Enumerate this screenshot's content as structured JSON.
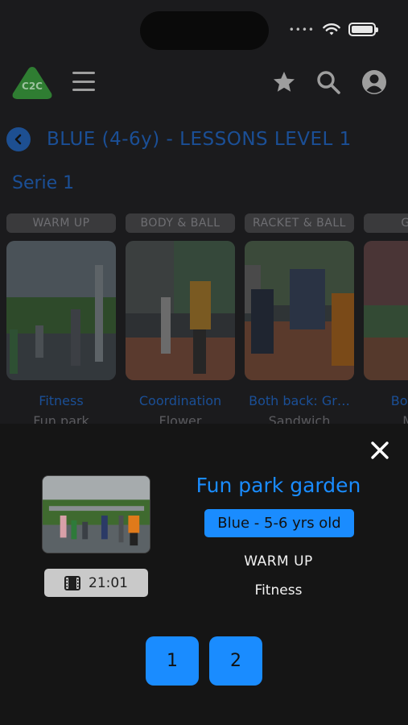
{
  "header": {
    "title": "BLUE (4-6y) - LESSONS LEVEL 1",
    "logo_text": "C2C",
    "icons": [
      "menu-icon",
      "star-icon",
      "search-icon",
      "user-icon"
    ]
  },
  "serie": {
    "label": "Serie 1"
  },
  "categories": [
    "WARM UP",
    "BODY & BALL",
    "RACKET & BALL",
    "GAME"
  ],
  "cards": [
    {
      "title": "Fitness",
      "subtitle": "Fun park"
    },
    {
      "title": "Coordination",
      "subtitle": "Flower"
    },
    {
      "title": "Both back: Gr…",
      "subtitle": "Sandwich"
    },
    {
      "title": "Both b…",
      "subtitle": "Mo…"
    }
  ],
  "sheet": {
    "lesson_title": "Fun park garden",
    "level_badge": "Blue - 5-6 yrs old",
    "category": "WARM UP",
    "subcategory": "Fitness",
    "duration": "21:01",
    "pages": [
      "1",
      "2"
    ]
  },
  "colors": {
    "accent": "#1a8cff",
    "dimmed_accent": "#1b4f96",
    "sheet_bg": "#151515",
    "page_bg": "#1b1b1d"
  }
}
